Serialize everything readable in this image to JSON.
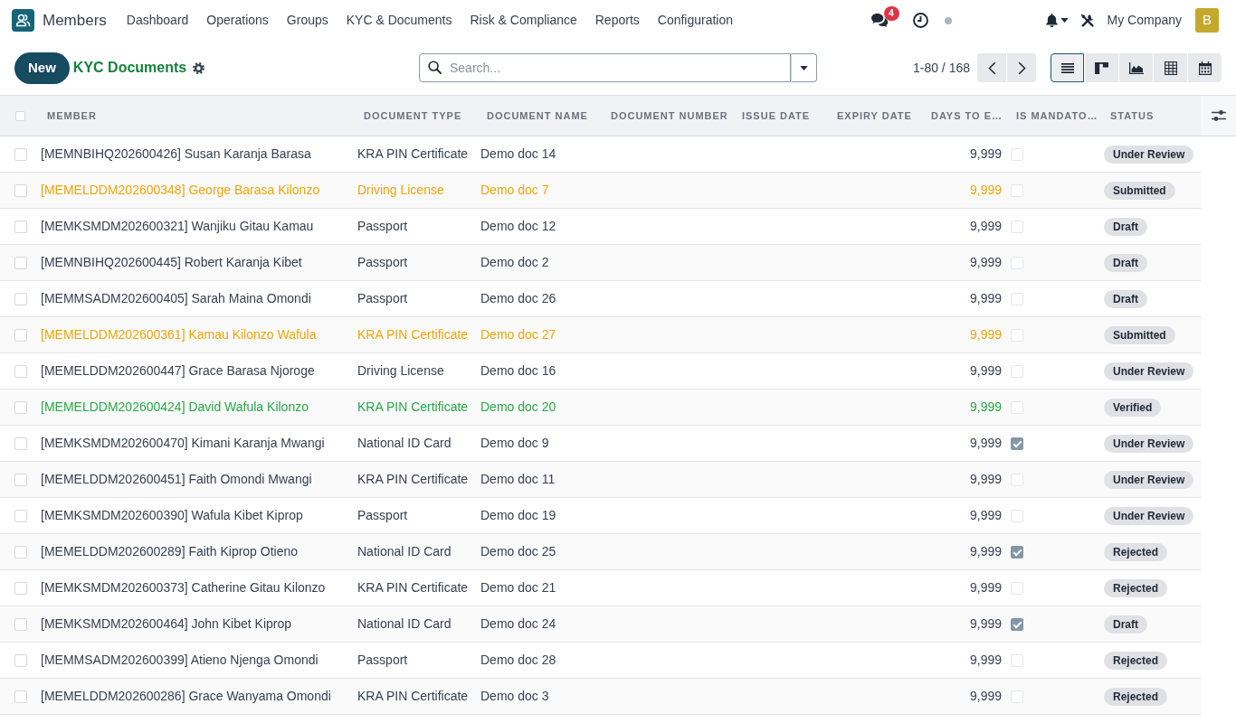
{
  "navbar": {
    "app_name": "Members",
    "menu": [
      "Dashboard",
      "Operations",
      "Groups",
      "KYC & Documents",
      "Risk & Compliance",
      "Reports",
      "Configuration"
    ],
    "messages_badge": "4",
    "company": "My Company",
    "avatar_letter": "B"
  },
  "control_panel": {
    "new_button": "New",
    "breadcrumb": "KYC Documents",
    "search": {
      "placeholder": "Search..."
    },
    "pager": "1-80 / 168",
    "views": [
      {
        "kind": "list",
        "selected": true
      },
      {
        "kind": "kanban",
        "selected": false
      },
      {
        "kind": "graph",
        "selected": false
      },
      {
        "kind": "pivot",
        "selected": false
      },
      {
        "kind": "calendar",
        "selected": false
      }
    ]
  },
  "table": {
    "all_selected": false,
    "columns": [
      "MEMBER",
      "DOCUMENT TYPE",
      "DOCUMENT NAME",
      "DOCUMENT NUMBER",
      "ISSUE DATE",
      "EXPIRY DATE",
      "DAYS TO E…",
      "IS MANDATO…",
      "STATUS"
    ],
    "rows": [
      {
        "selected": false,
        "member": "[MEMNBIHQ202600426] Susan Karanja Barasa",
        "document_type": "KRA PIN Certificate",
        "document_name": "Demo doc 14",
        "column_7": "9,999",
        "column_8_checked": false,
        "status": "Under Review",
        "color": "#374151"
      },
      {
        "selected": false,
        "member": "[MEMELDDM202600348] George Barasa Kilonzo",
        "document_type": "Driving License",
        "document_name": "Demo doc 7",
        "column_7": "9,999",
        "column_8_checked": false,
        "status": "Submitted",
        "color": "#f0a30a"
      },
      {
        "selected": false,
        "member": "[MEMKSMDM202600321] Wanjiku Gitau Kamau",
        "document_type": "Passport",
        "document_name": "Demo doc 12",
        "column_7": "9,999",
        "column_8_checked": false,
        "status": "Draft",
        "color": "#374151"
      },
      {
        "selected": false,
        "member": "[MEMNBIHQ202600445] Robert Karanja Kibet",
        "document_type": "Passport",
        "document_name": "Demo doc 2",
        "column_7": "9,999",
        "column_8_checked": false,
        "status": "Draft",
        "color": "#374151"
      },
      {
        "selected": false,
        "member": "[MEMMSADM202600405] Sarah Maina Omondi",
        "document_type": "Passport",
        "document_name": "Demo doc 26",
        "column_7": "9,999",
        "column_8_checked": false,
        "status": "Draft",
        "color": "#374151"
      },
      {
        "selected": false,
        "member": "[MEMELDDM202600361] Kamau Kilonzo Wafula",
        "document_type": "KRA PIN Certificate",
        "document_name": "Demo doc 27",
        "column_7": "9,999",
        "column_8_checked": false,
        "status": "Submitted",
        "color": "#f0a30a"
      },
      {
        "selected": false,
        "member": "[MEMELDDM202600447] Grace Barasa Njoroge",
        "document_type": "Driving License",
        "document_name": "Demo doc 16",
        "column_7": "9,999",
        "column_8_checked": false,
        "status": "Under Review",
        "color": "#374151"
      },
      {
        "selected": false,
        "member": "[MEMELDDM202600424] David Wafula Kilonzo",
        "document_type": "KRA PIN Certificate",
        "document_name": "Demo doc 20",
        "column_7": "9,999",
        "column_8_checked": false,
        "status": "Verified",
        "color": "#28a745"
      },
      {
        "selected": false,
        "member": "[MEMKSMDM202600470] Kimani Karanja Mwangi",
        "document_type": "National ID Card",
        "document_name": "Demo doc 9",
        "column_7": "9,999",
        "column_8_checked": true,
        "status": "Under Review",
        "color": "#374151"
      },
      {
        "selected": false,
        "member": "[MEMELDDM202600451] Faith Omondi Mwangi",
        "document_type": "KRA PIN Certificate",
        "document_name": "Demo doc 11",
        "column_7": "9,999",
        "column_8_checked": false,
        "status": "Under Review",
        "color": "#374151"
      },
      {
        "selected": false,
        "member": "[MEMKSMDM202600390] Wafula Kibet Kiprop",
        "document_type": "Passport",
        "document_name": "Demo doc 19",
        "column_7": "9,999",
        "column_8_checked": false,
        "status": "Under Review",
        "color": "#374151"
      },
      {
        "selected": false,
        "member": "[MEMELDDM202600289] Faith Kiprop Otieno",
        "document_type": "National ID Card",
        "document_name": "Demo doc 25",
        "column_7": "9,999",
        "column_8_checked": true,
        "status": "Rejected",
        "color": "#374151"
      },
      {
        "selected": false,
        "member": "[MEMKSMDM202600373] Catherine Gitau Kilonzo",
        "document_type": "KRA PIN Certificate",
        "document_name": "Demo doc 21",
        "column_7": "9,999",
        "column_8_checked": false,
        "status": "Rejected",
        "color": "#374151"
      },
      {
        "selected": false,
        "member": "[MEMKSMDM202600464] John Kibet Kiprop",
        "document_type": "National ID Card",
        "document_name": "Demo doc 24",
        "column_7": "9,999",
        "column_8_checked": true,
        "status": "Draft",
        "color": "#374151"
      },
      {
        "selected": false,
        "member": "[MEMMSADM202600399] Atieno Njenga Omondi",
        "document_type": "Passport",
        "document_name": "Demo doc 28",
        "column_7": "9,999",
        "column_8_checked": false,
        "status": "Rejected",
        "color": "#374151"
      },
      {
        "selected": false,
        "member": "[MEMELDDM202600286] Grace Wanyama Omondi",
        "document_type": "KRA PIN Certificate",
        "document_name": "Demo doc 3",
        "column_7": "9,999",
        "column_8_checked": false,
        "status": "Rejected",
        "color": "#374151"
      }
    ]
  }
}
